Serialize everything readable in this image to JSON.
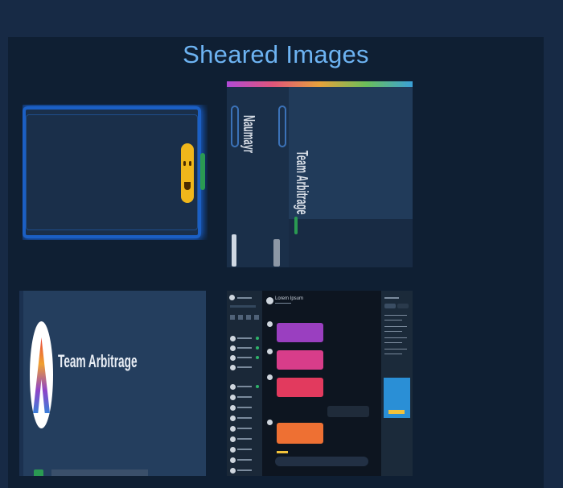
{
  "page": {
    "title": "Sheared Images"
  },
  "tiles": [
    {
      "name": "glow-bar-tile",
      "emoji": "smiley"
    },
    {
      "name": "stretched-app-tile",
      "labels": [
        "Naumayr",
        "Team Arbitrage"
      ]
    },
    {
      "name": "team-arbitrage-tile",
      "label": "Team Arbitrage"
    },
    {
      "name": "chat-ui-tile",
      "header": "Lorem Ipsum"
    }
  ],
  "colors": {
    "accent": "#6db3f2",
    "glow": "#1b5fc4",
    "panel": "#0f1f33",
    "background": "#172a45"
  }
}
